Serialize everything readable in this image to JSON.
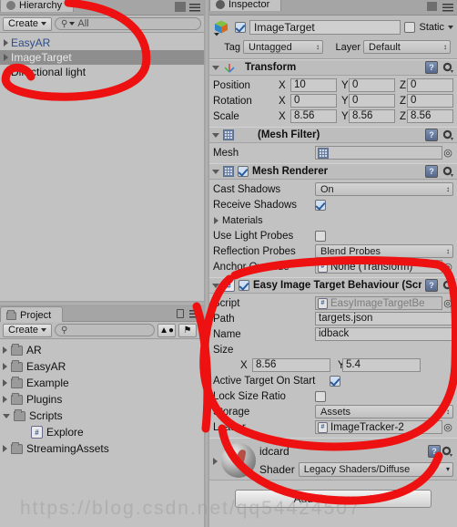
{
  "hierarchy": {
    "tab_label": "Hierarchy",
    "create_label": "Create",
    "search_placeholder": "All",
    "search_icon": "search-icon",
    "items": [
      {
        "label": "EasyAR",
        "selected": false,
        "prefab": true
      },
      {
        "label": "ImageTarget",
        "selected": true,
        "prefab": false
      },
      {
        "label": "Directional light",
        "selected": false,
        "prefab": false
      }
    ]
  },
  "project": {
    "tab_label": "Project",
    "create_label": "Create",
    "search_placeholder": "",
    "items": [
      {
        "label": "AR",
        "type": "folder",
        "expanded": false,
        "indent": 0
      },
      {
        "label": "EasyAR",
        "type": "folder",
        "expanded": false,
        "indent": 0
      },
      {
        "label": "Example",
        "type": "folder",
        "expanded": false,
        "indent": 0
      },
      {
        "label": "Plugins",
        "type": "folder",
        "expanded": false,
        "indent": 0
      },
      {
        "label": "Scripts",
        "type": "folder",
        "expanded": true,
        "indent": 0
      },
      {
        "label": "Explore",
        "type": "script",
        "expanded": null,
        "indent": 1
      },
      {
        "label": "StreamingAssets",
        "type": "folder",
        "expanded": false,
        "indent": 0
      }
    ]
  },
  "inspector": {
    "tab_label": "Inspector",
    "object_name": "ImageTarget",
    "object_enabled": true,
    "static_label": "Static",
    "static_checked": false,
    "tag_label": "Tag",
    "tag_value": "Untagged",
    "layer_label": "Layer",
    "layer_value": "Default",
    "components": [
      {
        "title": "Transform",
        "icon": "transform-icon",
        "has_checkbox": false,
        "rows": [
          {
            "label": "Position",
            "x": "10",
            "y": "0",
            "z": "0"
          },
          {
            "label": "Rotation",
            "x": "0",
            "y": "0",
            "z": "0"
          },
          {
            "label": "Scale",
            "x": "8.56",
            "y": "8.56",
            "z": "8.56"
          }
        ]
      },
      {
        "title": "(Mesh Filter)",
        "icon": "mesh-filter-icon",
        "has_checkbox": false,
        "mesh_label": "Mesh",
        "mesh_value": ""
      },
      {
        "title": "Mesh Renderer",
        "icon": "mesh-renderer-icon",
        "has_checkbox": true,
        "checked": true,
        "fields": [
          {
            "label": "Cast Shadows",
            "kind": "dropdown",
            "value": "On"
          },
          {
            "label": "Receive Shadows",
            "kind": "checkbox",
            "value": true
          },
          {
            "label": "Materials",
            "kind": "foldout",
            "value": ""
          },
          {
            "label": "Use Light Probes",
            "kind": "checkbox",
            "value": false
          },
          {
            "label": "Reflection Probes",
            "kind": "dropdown",
            "value": "Blend Probes"
          },
          {
            "label": "Anchor Override",
            "kind": "object",
            "value": "None (Transform)"
          }
        ]
      },
      {
        "title": "Easy Image Target Behaviour (Scr",
        "icon": "cs-script-icon",
        "has_checkbox": true,
        "checked": true,
        "fields": [
          {
            "label": "Script",
            "kind": "object-disabled",
            "value": "EasyImageTargetBe"
          },
          {
            "label": "Path",
            "kind": "text",
            "value": "targets.json"
          },
          {
            "label": "Name",
            "kind": "text",
            "value": "idback"
          },
          {
            "label": "Size",
            "kind": "header",
            "value": ""
          },
          {
            "label": "",
            "kind": "vector2",
            "x": "8.56",
            "y": "5.4"
          },
          {
            "label": "Active Target On Start",
            "kind": "checkbox",
            "value": true
          },
          {
            "label": "Lock Size Ratio",
            "kind": "checkbox",
            "value": false
          },
          {
            "label": "Storage",
            "kind": "dropdown",
            "value": "Assets"
          },
          {
            "label": "Loader",
            "kind": "object",
            "value": "ImageTracker-2"
          }
        ]
      }
    ],
    "material": {
      "name": "idcard",
      "shader_label": "Shader",
      "shader_value": "Legacy Shaders/Diffuse"
    },
    "add_component_label": "Add Component"
  },
  "watermark": "https://blog.csdn.net/qq54424507",
  "colors": {
    "panel_bg": "#c2c2c2",
    "header_bg": "#bdbdbd",
    "selection": "#8e8e8e",
    "prefab_text": "#2b4c8c",
    "annotation": "#ee1111",
    "field_bg": "#cbcbcb"
  }
}
